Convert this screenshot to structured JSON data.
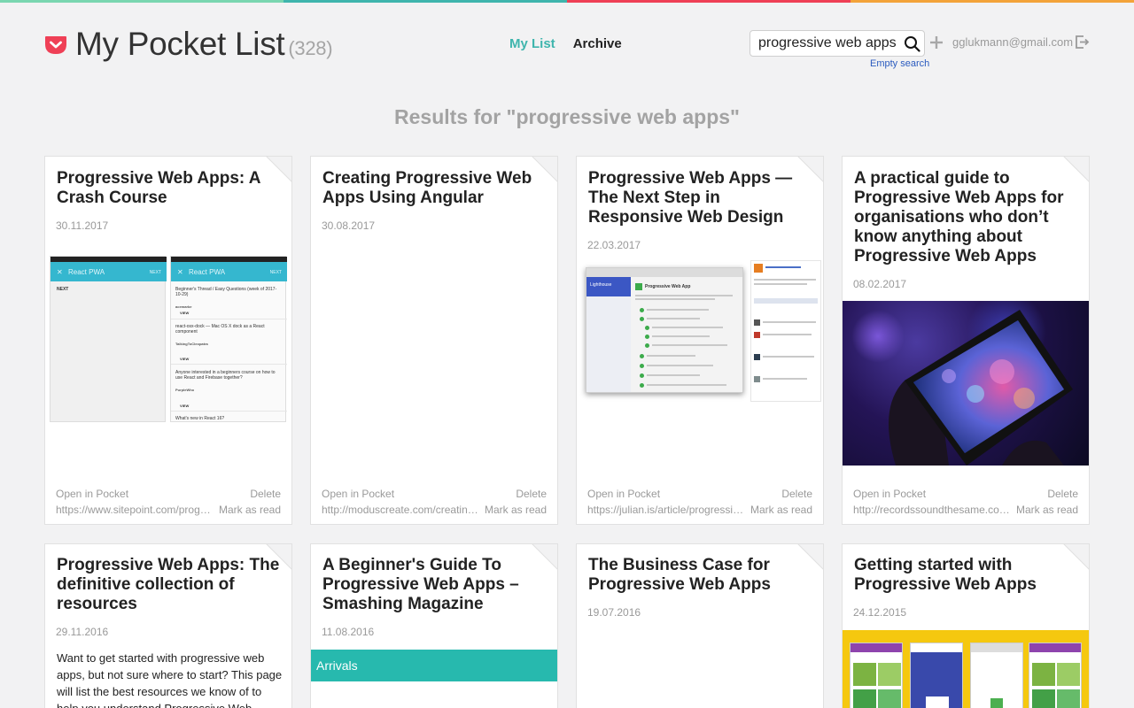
{
  "app": {
    "title": "My Pocket List",
    "count": "(328)",
    "top_colors": [
      "#7ad6b0",
      "#ef4056",
      "#f3a33a"
    ],
    "brand_color": "#ef4056",
    "accent_color": "#3fb5ad"
  },
  "nav": {
    "my_list": "My List",
    "archive": "Archive"
  },
  "search": {
    "value": "progressive web apps",
    "placeholder": "",
    "empty_label": "Empty search",
    "icon": "search-icon"
  },
  "user": {
    "email": "gglukmann@gmail.com",
    "add_icon": "plus-icon",
    "logout_icon": "logout-icon"
  },
  "results_heading": "Results for \"progressive web apps\"",
  "cards": [
    {
      "title": "Progressive Web Apps: A Crash Course",
      "date": "30.11.2017",
      "open": "Open in Pocket",
      "url": "https://www.sitepoint.com/progressive-web-apps-a-crash-course/",
      "delete": "Delete",
      "mark_read": "Mark as read",
      "image_text": {
        "bar_left": "React PWA",
        "bar_right": "NEXT",
        "left_item": "NEXT",
        "items": [
          "Beginner's Thread / Easy Questions (week of 2017-10-29)",
          "react-osx-dock — Mac OS X dock as a React component",
          "Anyone interested in a beginners course on how to use React and Firebase together?",
          "What's new in React 16?"
        ],
        "item_users": [
          "acemarke",
          "TalkingToCleopatra",
          "PurpleWho"
        ],
        "view": "VIEW"
      }
    },
    {
      "title": "Creating Progressive Web Apps Using Angular",
      "date": "30.08.2017",
      "open": "Open in Pocket",
      "url": "http://moduscreate.com/creating-progressive-web-apps-using-angular/",
      "delete": "Delete",
      "mark_read": "Mark as read"
    },
    {
      "title": "Progressive Web Apps — The Next Step in Responsive Web Design",
      "date": "22.03.2017",
      "open": "Open in Pocket",
      "url": "https://julian.is/article/progressive-web-apps/",
      "delete": "Delete",
      "mark_read": "Mark as read",
      "image_text": {
        "heading": "Progressive Web App",
        "side": "Lighthouse"
      }
    },
    {
      "title": "A practical guide to Progressive Web Apps for organisations who don’t know anything about Progressive Web Apps",
      "date": "08.02.2017",
      "open": "Open in Pocket",
      "url": "http://recordssoundthesame.com/blog/a-practical-guide-to-progressive-web-apps/",
      "delete": "Delete",
      "mark_read": "Mark as read"
    },
    {
      "title": "Progressive Web Apps: The definitive collection of resources",
      "date": "29.11.2016",
      "excerpt": "Want to get started with progressive web apps, but not sure where to start? This page will list the best resources we know of to help you understand Progressive Web"
    },
    {
      "title": "A Beginner's Guide To Progressive Web Apps – Smashing Magazine",
      "date": "11.08.2016",
      "image_text": {
        "banner": "Arrivals"
      }
    },
    {
      "title": "The Business Case for Progressive Web Apps",
      "date": "19.07.2016"
    },
    {
      "title": "Getting started with Progressive Web Apps",
      "date": "24.12.2015"
    }
  ]
}
